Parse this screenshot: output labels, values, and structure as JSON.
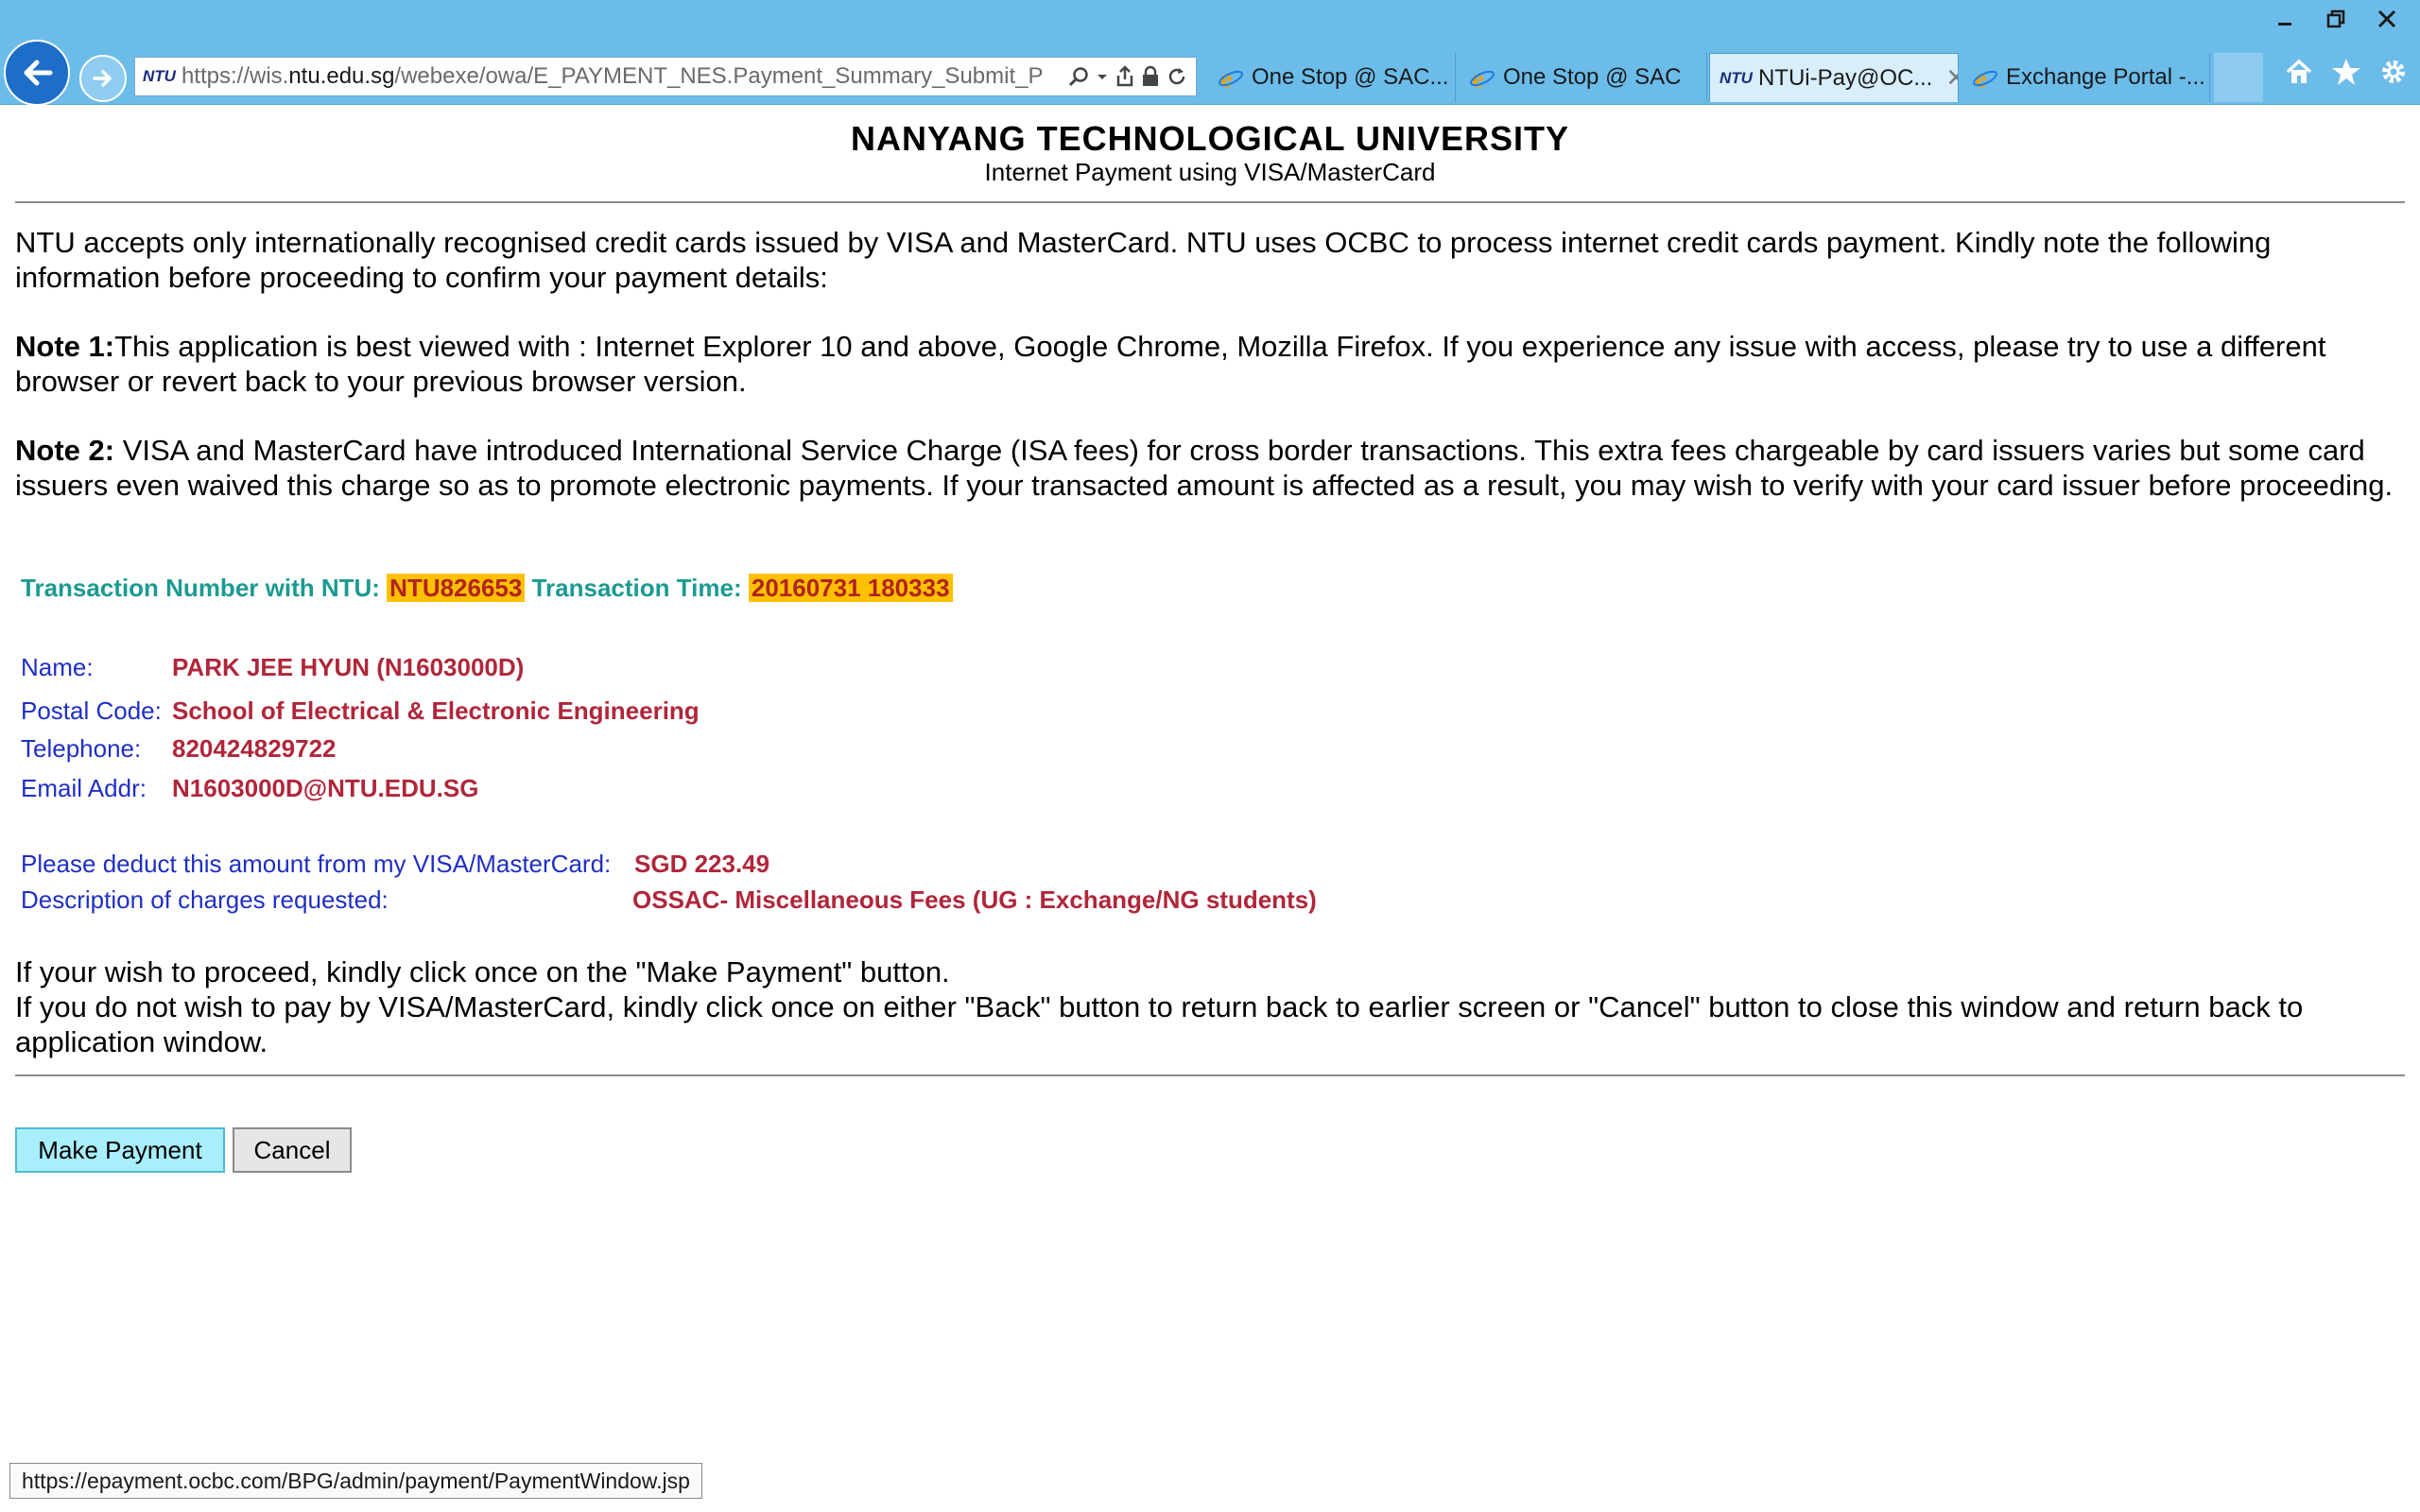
{
  "browser": {
    "url_prefix": "https://wis.",
    "url_host": "ntu.edu.sg",
    "url_path": "/webexe/owa/E_PAYMENT_NES.Payment_Summary_Submit_P",
    "favicon_text": "NTU",
    "tabs": [
      {
        "label": "One Stop @ SAC...",
        "active": false
      },
      {
        "label": "One Stop @ SAC",
        "active": false
      },
      {
        "label": "NTUi-Pay@OC...",
        "active": true
      },
      {
        "label": "Exchange Portal -...",
        "active": false
      }
    ],
    "accent_color": "#6cbcea"
  },
  "page": {
    "title": "NANYANG TECHNOLOGICAL UNIVERSITY",
    "subtitle": "Internet Payment using VISA/MasterCard",
    "intro": "NTU accepts only internationally recognised credit cards issued by VISA and MasterCard. NTU uses OCBC to process internet credit cards payment. Kindly note the following information before proceeding to confirm your payment details:",
    "note1_label": "Note 1:",
    "note1_text": "This application is best viewed with : Internet Explorer 10 and above, Google Chrome, Mozilla Firefox. If you experience any issue with access, please try to use a different browser or revert back to your previous browser version.",
    "note2_label": "Note 2:",
    "note2_text": " VISA and MasterCard have introduced International Service Charge (ISA fees) for cross border transactions. This extra fees chargeable by card issuers varies but some card issuers even waived this charge so as to promote electronic payments. If your transacted amount is affected as a result, you may wish to verify with your card issuer before proceeding."
  },
  "transaction": {
    "number_label": "Transaction Number with NTU:",
    "number": "NTU826653",
    "time_label": "Transaction Time:",
    "time": "20160731 180333"
  },
  "details": {
    "name_label": "Name:",
    "name": "PARK JEE HYUN (N1603000D)",
    "postal_label": "Postal Code:",
    "postal": "School of Electrical & Electronic Engineering",
    "phone_label": "Telephone:",
    "phone": "820424829722",
    "email_label": "Email Addr:",
    "email": "N1603000D@NTU.EDU.SG"
  },
  "charges": {
    "amount_label": "Please deduct this amount from my VISA/MasterCard:",
    "amount": "SGD 223.49",
    "desc_label": "Description of charges requested:",
    "desc": "OSSAC- Miscellaneous Fees (UG : Exchange/NG students)"
  },
  "instructions": {
    "line1": "If your wish to proceed, kindly click once on the \"Make Payment\" button.",
    "line2": "If you do not wish to pay by VISA/MasterCard, kindly click once on either \"Back\" button to return back to earlier screen or \"Cancel\" button to close this window and return back to application window."
  },
  "buttons": {
    "make_payment": "Make Payment",
    "cancel": "Cancel"
  },
  "status_bar": {
    "url": "https://epayment.ocbc.com/BPG/admin/payment/PaymentWindow.jsp"
  }
}
